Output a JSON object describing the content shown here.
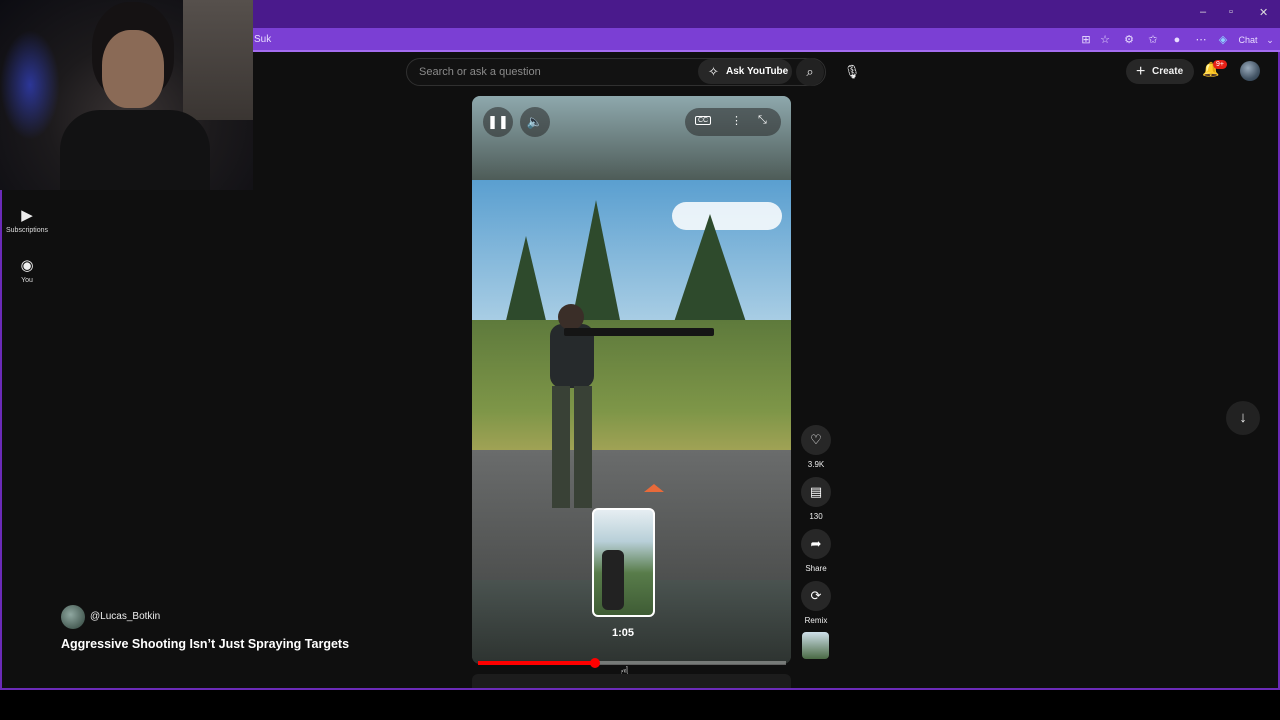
{
  "browser": {
    "tab_text": "Suk",
    "window_controls": [
      "–",
      "▫",
      "✕"
    ],
    "toolbar_chat_label": "Chat"
  },
  "sidebar": {
    "items": [
      {
        "label": "Subscriptions",
        "icon": "subscriptions-icon"
      },
      {
        "label": "You",
        "icon": "user-circle-icon"
      }
    ]
  },
  "header": {
    "search_placeholder": "Search or ask a question",
    "ask_label": "Ask YouTube",
    "create_label": "Create",
    "notification_badge": "9+"
  },
  "player": {
    "hover_time": "1:05",
    "progress_fraction": 0.38
  },
  "actions": [
    {
      "name": "like-button",
      "icon": "heart-icon",
      "label": "3.9K",
      "glyph": "♡"
    },
    {
      "name": "comments-button",
      "icon": "comment-icon",
      "label": "130",
      "glyph": "▤"
    },
    {
      "name": "share-button",
      "icon": "share-arrow-icon",
      "label": "Share",
      "glyph": "➦"
    },
    {
      "name": "remix-button",
      "icon": "remix-icon",
      "label": "Remix",
      "glyph": "⟳"
    }
  ],
  "short": {
    "channel": "@Lucas_Botkin",
    "title": "Aggressive Shooting Isn’t Just Spraying Targets"
  },
  "colors": {
    "accent_purple": "#7b3fd4",
    "progress_red": "#ff0000",
    "background": "#0f0f0f"
  }
}
